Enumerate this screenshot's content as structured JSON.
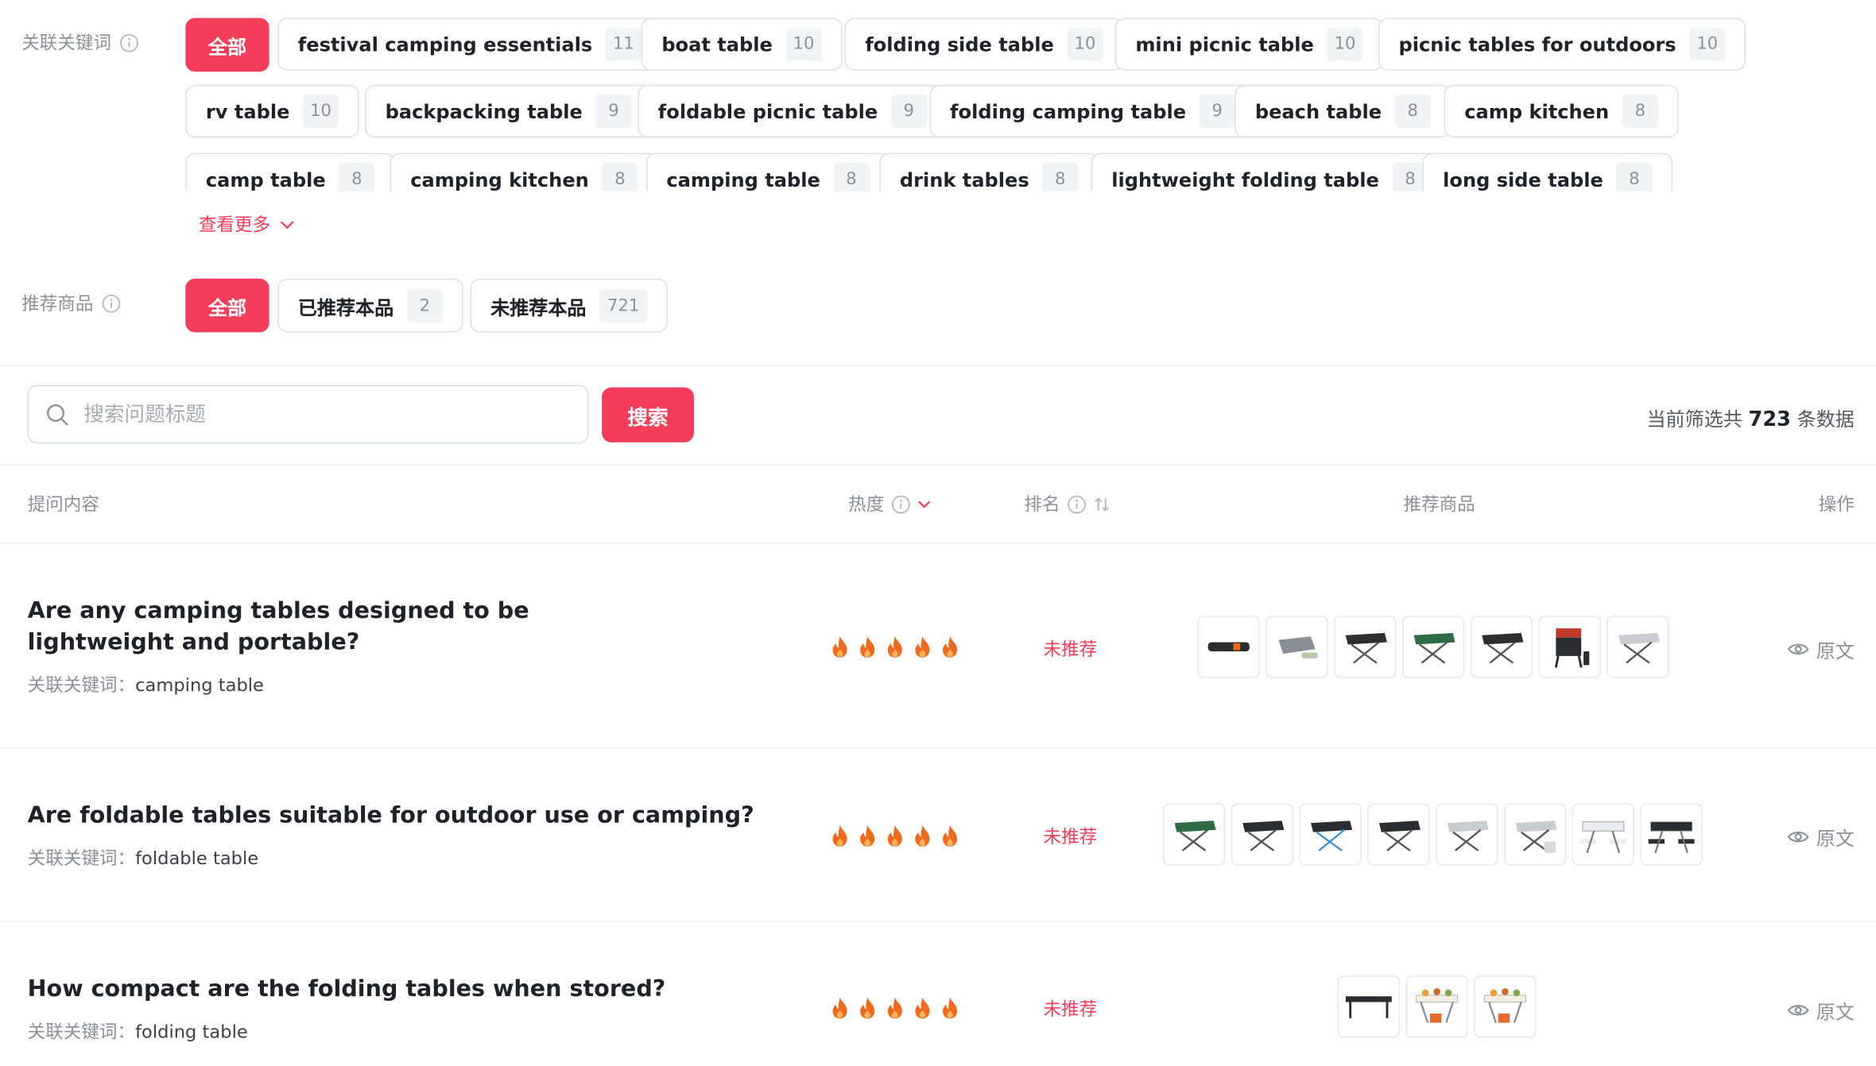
{
  "filters": {
    "keywords": {
      "label": "关联关键词",
      "all_label": "全部",
      "chips": [
        {
          "text": "festival camping essentials",
          "count": "11"
        },
        {
          "text": "boat table",
          "count": "10"
        },
        {
          "text": "folding side table",
          "count": "10"
        },
        {
          "text": "mini picnic table",
          "count": "10"
        },
        {
          "text": "picnic tables for outdoors",
          "count": "10"
        },
        {
          "text": "rv table",
          "count": "10"
        },
        {
          "text": "backpacking table",
          "count": "9"
        },
        {
          "text": "foldable picnic table",
          "count": "9"
        },
        {
          "text": "folding camping table",
          "count": "9"
        },
        {
          "text": "beach table",
          "count": "8"
        },
        {
          "text": "camp kitchen",
          "count": "8"
        },
        {
          "text": "camp table",
          "count": "8"
        },
        {
          "text": "camping kitchen",
          "count": "8"
        },
        {
          "text": "camping table",
          "count": "8"
        },
        {
          "text": "drink tables",
          "count": "8"
        },
        {
          "text": "lightweight folding table",
          "count": "8"
        },
        {
          "text": "long side table",
          "count": "8"
        }
      ],
      "more_label": "查看更多"
    },
    "products": {
      "label": "推荐商品",
      "all_label": "全部",
      "chips": [
        {
          "text": "已推荐本品",
          "count": "2"
        },
        {
          "text": "未推荐本品",
          "count": "721"
        }
      ]
    }
  },
  "search": {
    "placeholder": "搜索问题标题",
    "button_label": "搜索",
    "result_prefix": "当前筛选共",
    "result_count": "723",
    "result_suffix": "条数据"
  },
  "table": {
    "headers": {
      "question": "提问内容",
      "heat": "热度",
      "rank": "排名",
      "products": "推荐商品",
      "action": "操作"
    },
    "keyword_prefix": "关联关键词：",
    "rows": [
      {
        "title": "Are any camping tables designed to be lightweight and portable?",
        "keyword": "camping table",
        "heat_level": 5,
        "status": "未推荐",
        "action": "原文",
        "products": [
          "black-bag-table",
          "grey-roll-table",
          "black-folding-table",
          "green-folding-table",
          "dark-folding-table",
          "cooking-stand",
          "white-folding-table"
        ]
      },
      {
        "title": "Are foldable tables suitable for outdoor use or camping?",
        "keyword": "foldable table",
        "heat_level": 5,
        "status": "未推荐",
        "action": "原文",
        "products": [
          "green-folding-table",
          "dark-folding-table",
          "blue-leg-table",
          "black-square-table",
          "white-table",
          "white-table-bag",
          "white-picnic-set",
          "black-picnic-set"
        ]
      },
      {
        "title": "How compact are the folding tables when stored?",
        "keyword": "folding table",
        "heat_level": 5,
        "status": "未推荐",
        "action": "原文",
        "products": [
          "black-long-table",
          "buffet-table",
          "grill-table"
        ]
      }
    ]
  },
  "colors": {
    "accent": "#f43d5a",
    "flame": "#f06a1d",
    "text": "#1f2329",
    "muted": "#8c9099"
  }
}
